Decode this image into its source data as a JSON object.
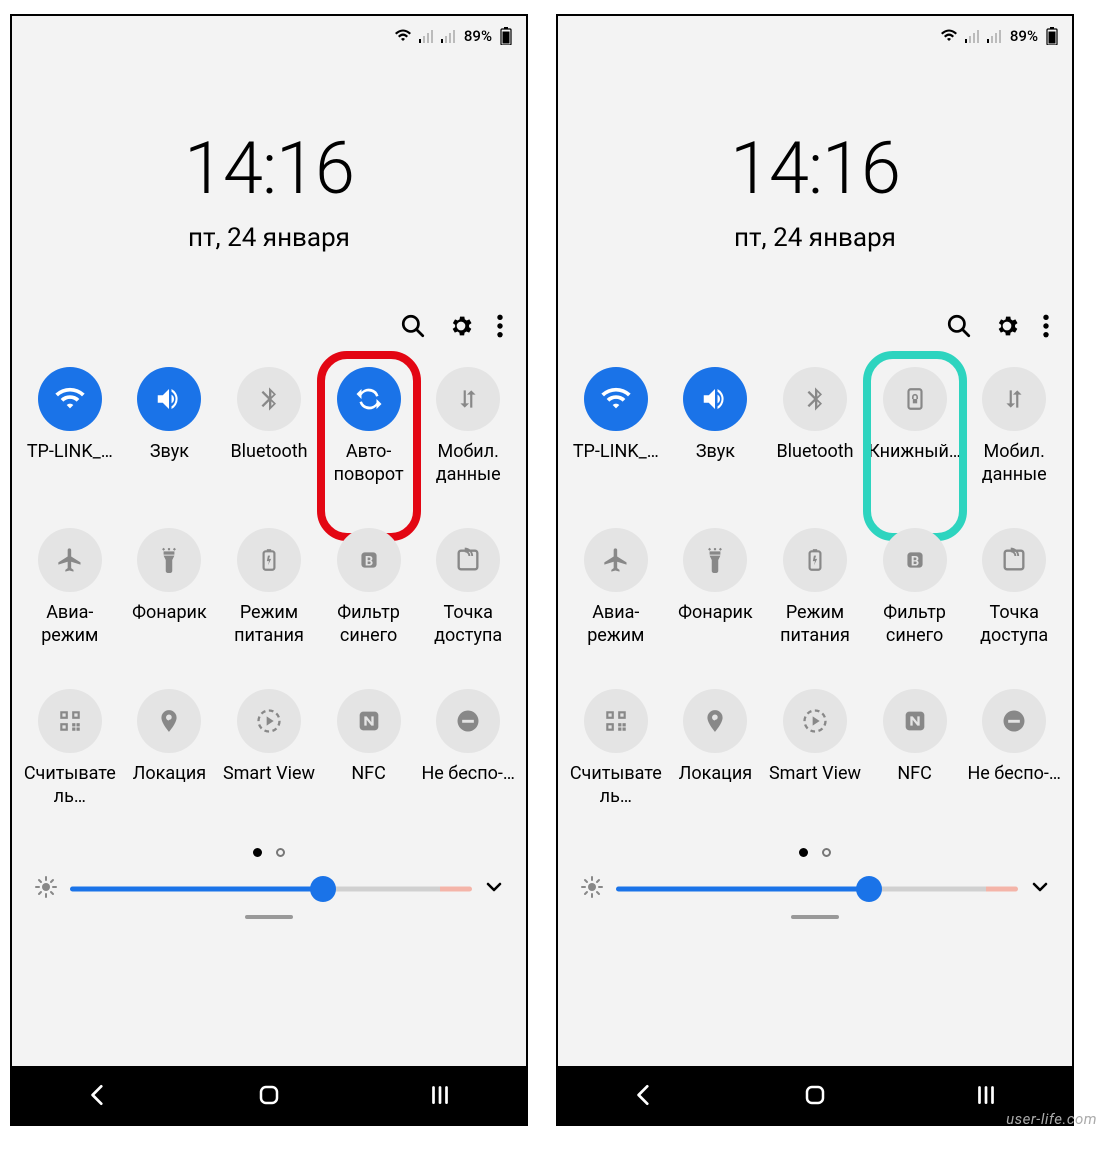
{
  "status": {
    "battery": "89%"
  },
  "clock": {
    "time": "14:16",
    "date": "пт, 24 января"
  },
  "phone_left": {
    "tiles": [
      {
        "id": "wifi",
        "label": "TP-LINK_…",
        "on": true,
        "icon": "wifi"
      },
      {
        "id": "sound",
        "label": "Звук",
        "on": true,
        "icon": "sound"
      },
      {
        "id": "bluetooth",
        "label": "Bluetooth",
        "on": false,
        "icon": "bluetooth"
      },
      {
        "id": "rotation",
        "label": "Авто-поворот",
        "on": true,
        "icon": "autorotate",
        "highlight": "red"
      },
      {
        "id": "mobiledata",
        "label": "Мобил. данные",
        "on": false,
        "icon": "mobiledata"
      },
      {
        "id": "airplane",
        "label": "Авиа-режим",
        "on": false,
        "icon": "airplane"
      },
      {
        "id": "flashlight",
        "label": "Фонарик",
        "on": false,
        "icon": "flashlight"
      },
      {
        "id": "powermode",
        "label": "Режим питания",
        "on": false,
        "icon": "powermode"
      },
      {
        "id": "bluefilter",
        "label": "Фильтр синего",
        "on": false,
        "icon": "bluefilter"
      },
      {
        "id": "hotspot",
        "label": "Точка доступа",
        "on": false,
        "icon": "hotspot"
      },
      {
        "id": "qr",
        "label": "Считыватель…",
        "on": false,
        "icon": "qr"
      },
      {
        "id": "location",
        "label": "Локация",
        "on": false,
        "icon": "location"
      },
      {
        "id": "smartview",
        "label": "Smart View",
        "on": false,
        "icon": "smartview"
      },
      {
        "id": "nfc",
        "label": "NFC",
        "on": false,
        "icon": "nfc"
      },
      {
        "id": "dnd",
        "label": "Не беспо-…",
        "on": false,
        "icon": "dnd"
      }
    ]
  },
  "phone_right": {
    "tiles": [
      {
        "id": "wifi",
        "label": "TP-LINK_…",
        "on": true,
        "icon": "wifi"
      },
      {
        "id": "sound",
        "label": "Звук",
        "on": true,
        "icon": "sound"
      },
      {
        "id": "bluetooth",
        "label": "Bluetooth",
        "on": false,
        "icon": "bluetooth"
      },
      {
        "id": "rotation",
        "label": "Книжный…",
        "on": false,
        "icon": "portraitlock",
        "highlight": "teal"
      },
      {
        "id": "mobiledata",
        "label": "Мобил. данные",
        "on": false,
        "icon": "mobiledata"
      },
      {
        "id": "airplane",
        "label": "Авиа-режим",
        "on": false,
        "icon": "airplane"
      },
      {
        "id": "flashlight",
        "label": "Фонарик",
        "on": false,
        "icon": "flashlight"
      },
      {
        "id": "powermode",
        "label": "Режим питания",
        "on": false,
        "icon": "powermode"
      },
      {
        "id": "bluefilter",
        "label": "Фильтр синего",
        "on": false,
        "icon": "bluefilter"
      },
      {
        "id": "hotspot",
        "label": "Точка доступа",
        "on": false,
        "icon": "hotspot"
      },
      {
        "id": "qr",
        "label": "Считыватель…",
        "on": false,
        "icon": "qr"
      },
      {
        "id": "location",
        "label": "Локация",
        "on": false,
        "icon": "location"
      },
      {
        "id": "smartview",
        "label": "Smart View",
        "on": false,
        "icon": "smartview"
      },
      {
        "id": "nfc",
        "label": "NFC",
        "on": false,
        "icon": "nfc"
      },
      {
        "id": "dnd",
        "label": "Не беспо-…",
        "on": false,
        "icon": "dnd"
      }
    ]
  },
  "brightness_pct": 63,
  "watermark": "user-life.com"
}
